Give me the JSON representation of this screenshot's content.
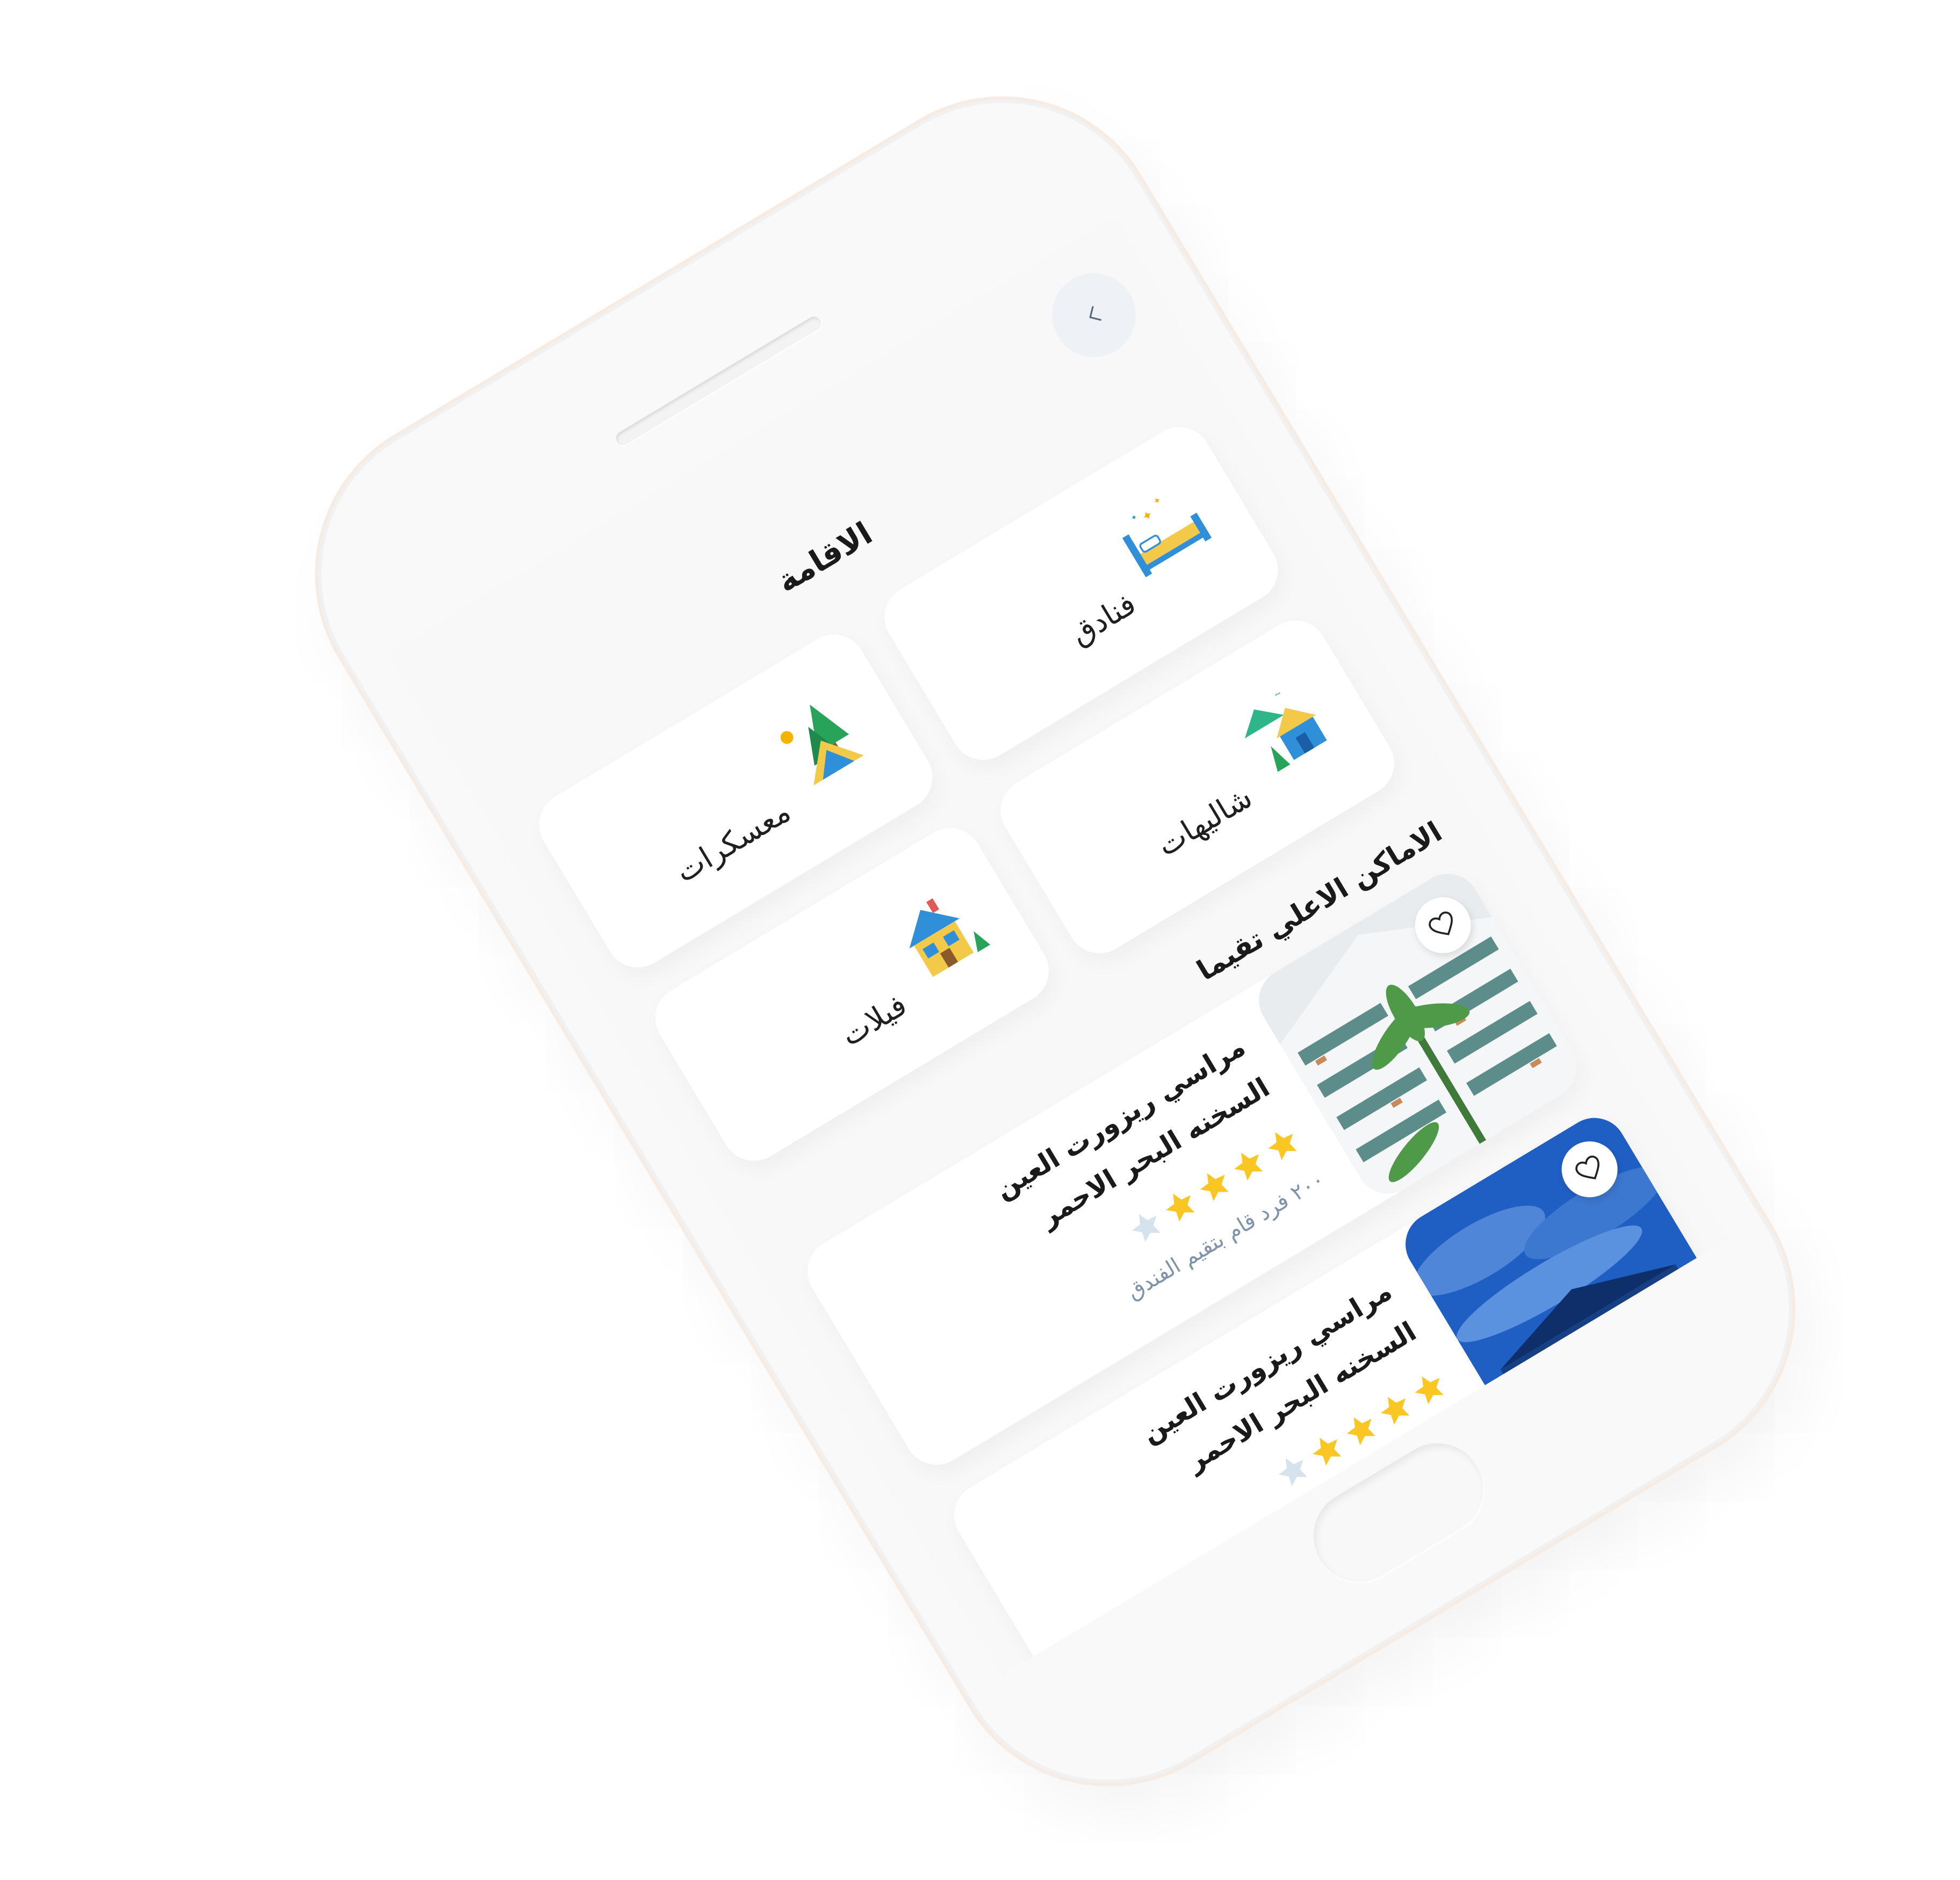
{
  "header": {
    "title": "الاقامة",
    "back_icon": "chevron-left-icon"
  },
  "categories": [
    {
      "label": "فنادق",
      "icon": "bed-icon"
    },
    {
      "label": "معسكرات",
      "icon": "camp-tent-icon"
    },
    {
      "label": "شاليهات",
      "icon": "chalet-house-icon"
    },
    {
      "label": "فيلات",
      "icon": "villa-house-icon"
    }
  ],
  "top_rated": {
    "title": "الاماكن الاعلي تقيما",
    "hotels": [
      {
        "name": "مراسي ريزورت العين السخنه البحر الاحمر",
        "rating": 4,
        "max_rating": 5,
        "rating_note": "٢٠٠ فرد قام بتقيم الفندق",
        "favorite_icon": "heart-icon"
      },
      {
        "name": "مراسي ريزورت العين السخنه البحر الاحمر",
        "rating": 4,
        "max_rating": 5,
        "favorite_icon": "heart-icon"
      }
    ]
  },
  "colors": {
    "star_filled": "#f9c623",
    "star_empty": "#d6e2ec",
    "muted_text": "#7f93a8",
    "back_button_bg": "#eef2f6"
  }
}
